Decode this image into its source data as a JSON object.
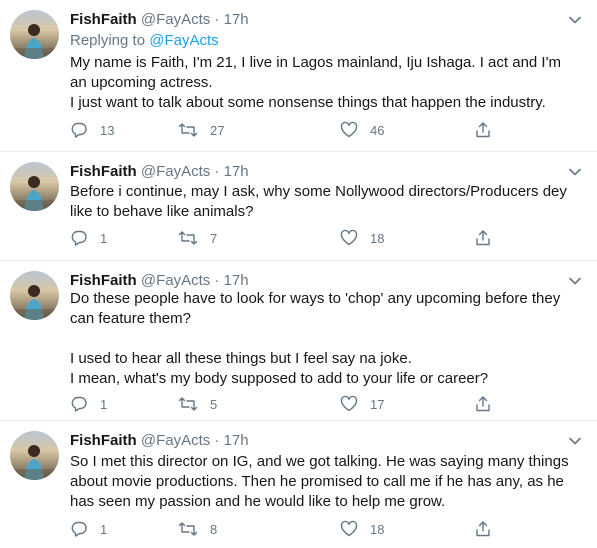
{
  "colors": {
    "text": "#14171a",
    "muted": "#657786",
    "link": "#1da1f2",
    "divider": "#e6ecf0"
  },
  "tweets": [
    {
      "name": "FishFaith",
      "handle": "@FayActs",
      "dot": "·",
      "time": "17h",
      "replying_prefix": "Replying to",
      "replying_to": "@FayActs",
      "text": "My name is Faith, I'm 21, I live in Lagos mainland, Iju Ishaga. I act and I'm an upcoming actress.\nI just want to talk about some nonsense things that happen the industry.",
      "reply_count": "13",
      "retweet_count": "27",
      "like_count": "46"
    },
    {
      "name": "FishFaith",
      "handle": "@FayActs",
      "dot": "·",
      "time": "17h",
      "text": "Before i continue, may I ask, why some Nollywood directors/Producers dey like to behave like animals?",
      "reply_count": "1",
      "retweet_count": "7",
      "like_count": "18"
    },
    {
      "name": "FishFaith",
      "handle": "@FayActs",
      "dot": "·",
      "time": "17h",
      "text": "Do these people have to look for ways to 'chop' any upcoming before they can feature them?\n\nI used to hear all these things but I feel say na joke.\nI mean, what's my body supposed to add to your life or career?",
      "reply_count": "1",
      "retweet_count": "5",
      "like_count": "17"
    },
    {
      "name": "FishFaith",
      "handle": "@FayActs",
      "dot": "·",
      "time": "17h",
      "text": "So I met this director on IG, and we got talking. He was saying many things about movie productions. Then he promised to call me if he has any, as he has seen my passion and he would like to help me grow.",
      "reply_count": "1",
      "retweet_count": "8",
      "like_count": "18"
    }
  ]
}
